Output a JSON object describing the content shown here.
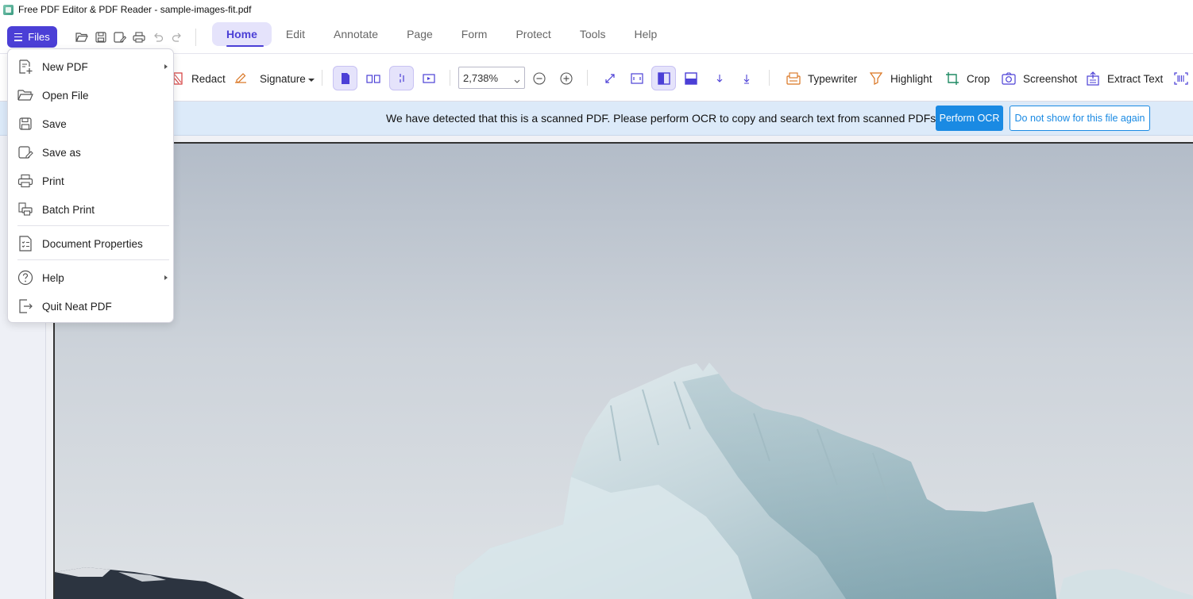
{
  "window": {
    "title": "Free PDF Editor & PDF Reader - sample-images-fit.pdf"
  },
  "menubar": {
    "files_label": "Files",
    "tabs": [
      {
        "label": "Home",
        "active": true
      },
      {
        "label": "Edit"
      },
      {
        "label": "Annotate"
      },
      {
        "label": "Page"
      },
      {
        "label": "Form"
      },
      {
        "label": "Protect"
      },
      {
        "label": "Tools"
      },
      {
        "label": "Help"
      }
    ]
  },
  "toolbar": {
    "redact_label": "Redact",
    "signature_label": "Signature",
    "zoom_value": "2,738%",
    "typewriter_label": "Typewriter",
    "highlight_label": "Highlight",
    "crop_label": "Crop",
    "screenshot_label": "Screenshot",
    "extract_text_label": "Extract Text"
  },
  "ocr_banner": {
    "message": "We have detected that this is a scanned PDF.  Please perform OCR to copy and search text from scanned PDFs.",
    "perform_label": "Perform OCR",
    "dismiss_label": "Do not show for this file again"
  },
  "files_menu": {
    "items": [
      {
        "label": "New PDF",
        "icon": "new-pdf-icon",
        "submenu": true
      },
      {
        "label": "Open File",
        "icon": "folder-open-icon"
      },
      {
        "label": "Save",
        "icon": "save-icon"
      },
      {
        "label": "Save as",
        "icon": "save-as-icon"
      },
      {
        "label": "Print",
        "icon": "print-icon"
      },
      {
        "label": "Batch Print",
        "icon": "batch-print-icon"
      },
      {
        "label": "Document Properties",
        "icon": "document-properties-icon"
      },
      {
        "label": "Help",
        "icon": "help-icon",
        "submenu": true
      },
      {
        "label": "Quit Neat PDF",
        "icon": "quit-icon"
      }
    ]
  },
  "colors": {
    "accent": "#4b3fd6",
    "ocr_button": "#1a8ae3",
    "banner_bg": "#dceaf9"
  }
}
